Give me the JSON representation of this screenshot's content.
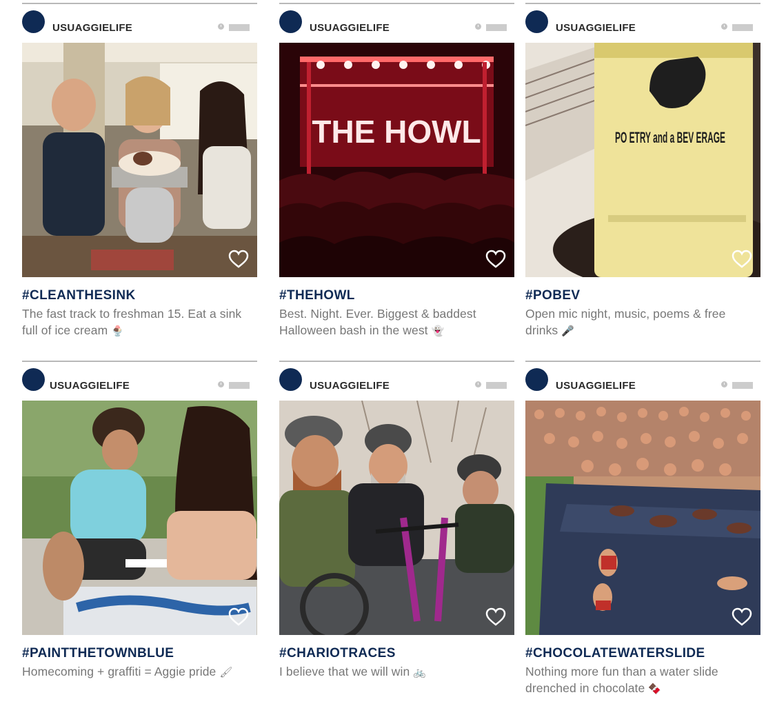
{
  "posts": [
    {
      "username": "USUAGGIELIFE",
      "hashtag": "#CLEANTHESINK",
      "caption": "The fast track to freshman 15. Eat a sink full of ice cream",
      "emoji": "🍨",
      "photo_icon": "ice-cream-photo"
    },
    {
      "username": "USUAGGIELIFE",
      "hashtag": "#THEHOWL",
      "caption": "Best. Night. Ever. Biggest & baddest Halloween bash in the west",
      "emoji": "👻",
      "photo_icon": "concert-photo",
      "photo_text": "THE HOWL"
    },
    {
      "username": "USUAGGIELIFE",
      "hashtag": "#POBEV",
      "caption": "Open mic night, music, poems & free drinks",
      "emoji": "🎤",
      "photo_icon": "cup-guitar-photo",
      "photo_text": "PO ETRY and a BEV ERAGE"
    },
    {
      "username": "USUAGGIELIFE",
      "hashtag": "#PAINTTHETOWNBLUE",
      "caption": "Homecoming + graffiti = Aggie pride",
      "emoji": "🖌",
      "photo_icon": "painting-photo"
    },
    {
      "username": "USUAGGIELIFE",
      "hashtag": "#CHARIOTRACES",
      "caption": "I believe that we will win",
      "emoji": "🚲",
      "photo_icon": "bike-riders-photo"
    },
    {
      "username": "USUAGGIELIFE",
      "hashtag": "#CHOCOLATEWATERSLIDE",
      "caption": "Nothing more fun than a water slide drenched in chocolate",
      "emoji": "🍫",
      "photo_icon": "water-slide-photo"
    }
  ],
  "colors": {
    "brand_navy": "#0f2a54",
    "caption_gray": "#777777",
    "divider": "#b8b8b8"
  }
}
